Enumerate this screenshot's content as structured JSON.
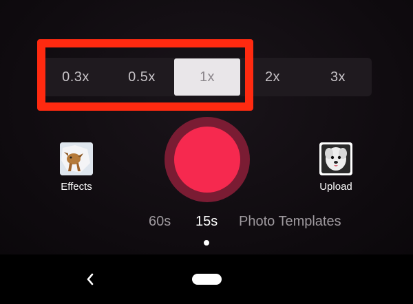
{
  "zoom": {
    "options": [
      "0.3x",
      "0.5x",
      "1x",
      "2x",
      "3x"
    ],
    "selected": "1x"
  },
  "effects": {
    "label": "Effects",
    "icon": "effects-thumbnail-icon"
  },
  "upload": {
    "label": "Upload",
    "icon": "gallery-thumbnail-icon"
  },
  "record": {
    "icon": "record-icon",
    "color": "#f6294f",
    "ring_color": "#7a1c33"
  },
  "durations": {
    "items": [
      "60s",
      "15s",
      "Photo Templates"
    ],
    "active": "15s"
  },
  "nav": {
    "back_icon": "back-chevron-icon",
    "home_icon": "home-pill-icon"
  },
  "colors": {
    "highlight": "#ff2a10",
    "selected_bg": "#e9e6e9"
  }
}
